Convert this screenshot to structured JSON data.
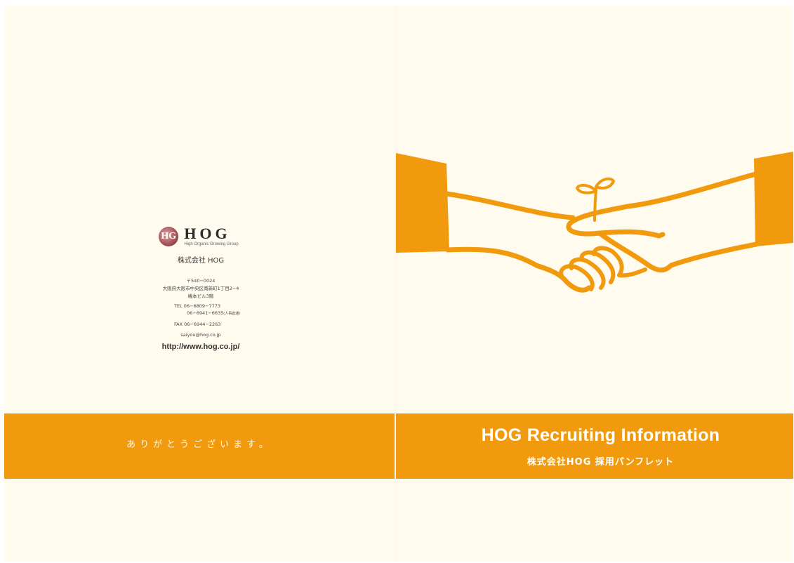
{
  "back_cover": {
    "logo": {
      "mark_letters": "HG",
      "word": "HOG",
      "tagline": "High Organic Growing Group"
    },
    "company_name": "株式会社 HOG",
    "postal_code": "〒540−0024",
    "address": "大阪府大阪市中央区南新町1丁目2−4",
    "building": "椿本ビル3階",
    "tel_label": "TEL",
    "tel_main": "06−6809−7773",
    "tel_hr": "06−6941−6635",
    "tel_hr_note": "(人事直通)",
    "fax_label": "FAX",
    "fax": "06−6944−2263",
    "email": "saiyou@hog.co.jp",
    "url": "http://www.hog.co.jp/",
    "thanks": "ありがとうございます。"
  },
  "front_cover": {
    "title": "HOG  Recruiting Information",
    "subtitle": "株式会社HOG 採用パンフレット"
  },
  "colors": {
    "background": "#fffcef",
    "accent_orange": "#f29a0e",
    "text_dark": "#333333"
  },
  "illustration": {
    "icon": "handshake-with-sprout-illustration"
  }
}
